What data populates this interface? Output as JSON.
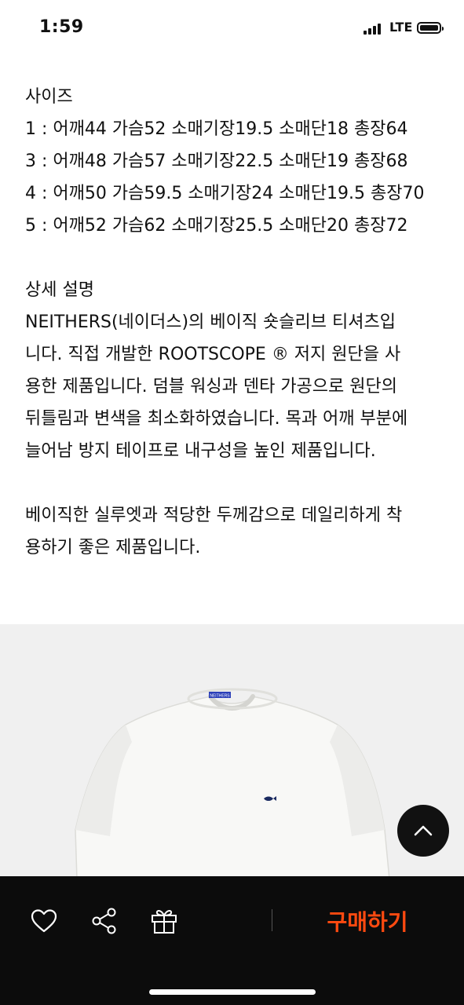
{
  "status_bar": {
    "time": "1:59",
    "network": "LTE"
  },
  "sizes": {
    "heading": "사이즈",
    "rows": [
      "1 : 어깨44 가슴52 소매기장19.5 소매단18 총장64",
      "3 : 어깨48 가슴57 소매기장22.5 소매단19 총장68",
      "4 : 어깨50 가슴59.5 소매기장24 소매단19.5 총장70",
      "5 : 어깨52 가슴62 소매기장25.5 소매단20 총장72"
    ]
  },
  "description": {
    "heading": "상세 설명",
    "lines": [
      "NEITHERS(네이더스)의 베이직 숏슬리브 티셔츠입",
      "니다. 직접 개발한 ROOTSCOPE ® 저지 원단을 사",
      "용한 제품입니다. 덤블 워싱과 덴타 가공으로 원단의",
      "뒤틀림과 변색을 최소화하였습니다. 목과 어깨 부분에",
      "늘어남 방지 테이프로 내구성을 높인 제품입니다."
    ],
    "lines2": [
      "베이직한 실루엣과 적당한 두께감으로 데일리하게 착",
      "용하기 좋은 제품입니다."
    ]
  },
  "product_image": {
    "label_text": "NEITHERS"
  },
  "bottom_bar": {
    "buy_label": "구매하기",
    "accent_color": "#ff4a10",
    "icons": [
      "heart-icon",
      "share-icon",
      "gift-icon"
    ]
  },
  "scroll_top": {
    "icon": "chevron-up-icon"
  }
}
